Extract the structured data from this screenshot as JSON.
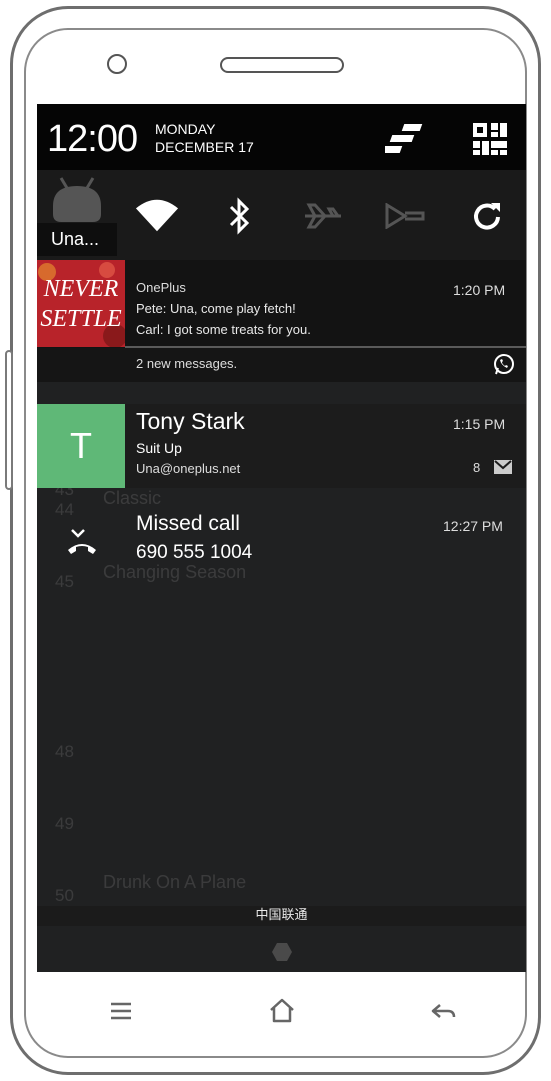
{
  "statusbar": {
    "time": "12:00",
    "day": "MONDAY",
    "date": "DECEMBER 17",
    "toggle_icon": "quick-settings-toggle-icon",
    "grid_icon": "grid-icon"
  },
  "quick_settings": [
    {
      "name": "wifi",
      "icon": "wifi-icon",
      "state": "on"
    },
    {
      "name": "bluetooth",
      "icon": "bluetooth-icon",
      "state": "on"
    },
    {
      "name": "airplane",
      "icon": "airplane-icon",
      "state": "off"
    },
    {
      "name": "data",
      "icon": "data-icon",
      "state": "off"
    },
    {
      "name": "auto-rotate",
      "icon": "rotate-icon",
      "state": "on"
    }
  ],
  "user_badge": "Una...",
  "background_list": [
    {
      "num": "",
      "title": "",
      "sub": ""
    },
    {
      "num": "",
      "title": "",
      "sub": ""
    },
    {
      "num": "",
      "title": "",
      "sub": ""
    },
    {
      "num": "43",
      "title": "",
      "sub": ""
    },
    {
      "num": "44",
      "title": "Classic",
      "sub": ""
    },
    {
      "num": "45",
      "title": "Changing Season",
      "sub": ""
    },
    {
      "num": "",
      "title": "",
      "sub": ""
    },
    {
      "num": "48",
      "title": "",
      "sub": ""
    },
    {
      "num": "49",
      "title": "",
      "sub": ""
    },
    {
      "num": "50",
      "title": "Drunk On A Plane",
      "sub": ""
    }
  ],
  "notifications": {
    "messages": {
      "app": "OnePlus",
      "line1": "Pete: Una, come play fetch!",
      "line2": "Carl: I got some treats for you.",
      "time": "1:20 PM",
      "summary": "2 new messages.",
      "image_text_1": "NEVER",
      "image_text_2": "SETTLE"
    },
    "email": {
      "avatar_letter": "T",
      "title": "Tony Stark",
      "subject": "Suit Up",
      "account": "Una@oneplus.net",
      "time": "1:15 PM",
      "count": "8"
    },
    "missed_call": {
      "title": "Missed call",
      "number": "690 555 1004",
      "time": "12:27 PM"
    }
  },
  "carrier": "中国联通",
  "colors": {
    "avatar_green": "#5fb877",
    "never_settle_red": "#c22a2a"
  }
}
